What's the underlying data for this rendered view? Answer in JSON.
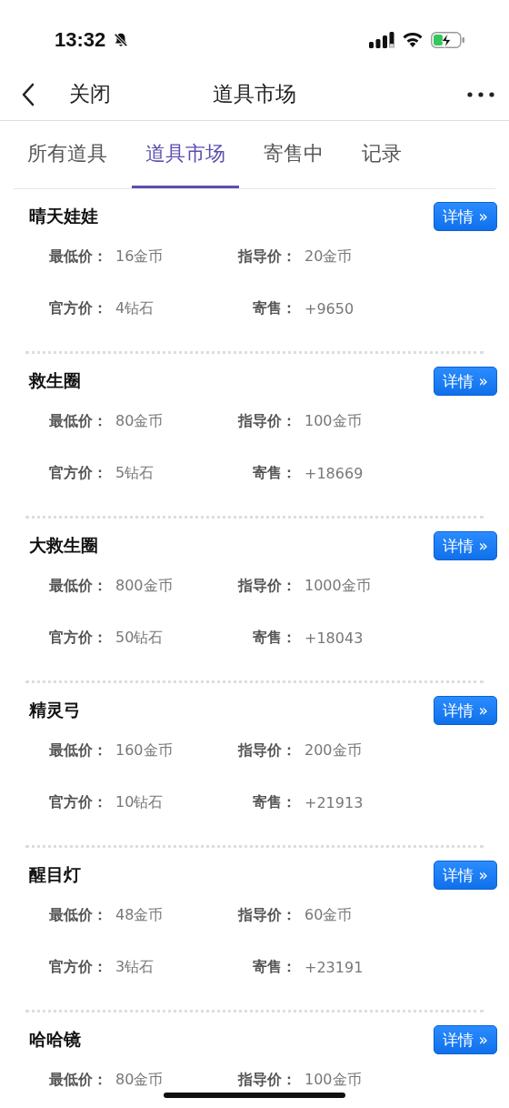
{
  "status_bar": {
    "time": "13:32"
  },
  "nav": {
    "close": "关闭",
    "title": "道具市场"
  },
  "tabs": [
    {
      "label": "所有道具",
      "selected": false
    },
    {
      "label": "道具市场",
      "selected": true
    },
    {
      "label": "寄售中",
      "selected": false
    },
    {
      "label": "记录",
      "selected": false
    }
  ],
  "items": [
    {
      "name": "晴天娃娃",
      "button": "详情 »",
      "rows": [
        [
          {
            "label": "最低价：",
            "value": "16金币"
          },
          {
            "label": "指导价：",
            "value": "20金币"
          }
        ],
        [
          {
            "label": "官方价：",
            "value": "4钻石"
          },
          {
            "label": "寄售：",
            "value": "+9650"
          }
        ]
      ]
    },
    {
      "name": "救生圈",
      "button": "详情 »",
      "rows": [
        [
          {
            "label": "最低价：",
            "value": "80金币"
          },
          {
            "label": "指导价：",
            "value": "100金币"
          }
        ],
        [
          {
            "label": "官方价：",
            "value": "5钻石"
          },
          {
            "label": "寄售：",
            "value": "+18669"
          }
        ]
      ]
    },
    {
      "name": "大救生圈",
      "button": "详情 »",
      "rows": [
        [
          {
            "label": "最低价：",
            "value": "800金币"
          },
          {
            "label": "指导价：",
            "value": "1000金币"
          }
        ],
        [
          {
            "label": "官方价：",
            "value": "50钻石"
          },
          {
            "label": "寄售：",
            "value": "+18043"
          }
        ]
      ]
    },
    {
      "name": "精灵弓",
      "button": "详情 »",
      "rows": [
        [
          {
            "label": "最低价：",
            "value": "160金币"
          },
          {
            "label": "指导价：",
            "value": "200金币"
          }
        ],
        [
          {
            "label": "官方价：",
            "value": "10钻石"
          },
          {
            "label": "寄售：",
            "value": "+21913"
          }
        ]
      ]
    },
    {
      "name": "醒目灯",
      "button": "详情 »",
      "rows": [
        [
          {
            "label": "最低价：",
            "value": "48金币"
          },
          {
            "label": "指导价：",
            "value": "60金币"
          }
        ],
        [
          {
            "label": "官方价：",
            "value": "3钻石"
          },
          {
            "label": "寄售：",
            "value": "+23191"
          }
        ]
      ]
    },
    {
      "name": "哈哈镜",
      "button": "详情 »",
      "rows": [
        [
          {
            "label": "最低价：",
            "value": "80金币"
          },
          {
            "label": "指导价：",
            "value": "100金币"
          }
        ]
      ]
    }
  ]
}
